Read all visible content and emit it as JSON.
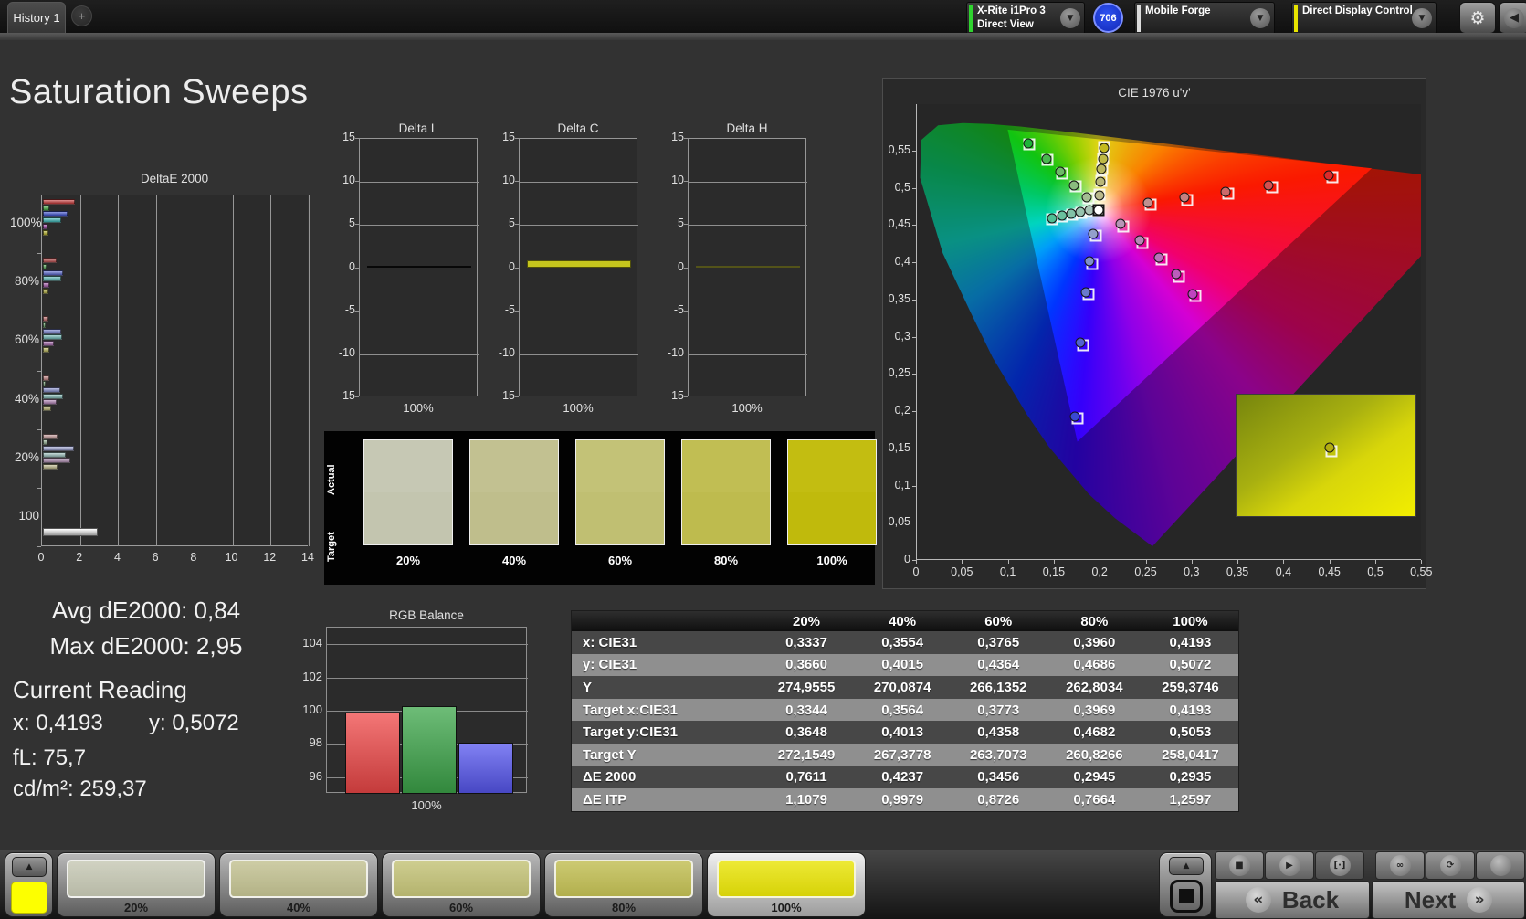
{
  "topbar": {
    "tabs": [
      {
        "label": "History 1",
        "active": true
      }
    ],
    "add_tab_icon": "+",
    "devices": [
      {
        "line1": "X-Rite i1Pro 3",
        "line2": "Direct View",
        "accent": "#2fd42f"
      },
      {
        "line1": "Mobile Forge",
        "line2": "",
        "accent": "#dcdcdc"
      },
      {
        "line1": "Direct Display Control",
        "line2": "",
        "accent": "#e8e400"
      }
    ],
    "badge": "706",
    "gear_icon": "⚙",
    "collapse_icon": "◀",
    "chevron_icon": "▼"
  },
  "page_title": "Saturation Sweeps",
  "stats": {
    "avg": "Avg dE2000: 0,84",
    "max": "Max dE2000: 2,95",
    "current_reading_title": "Current Reading",
    "x": "x: 0,4193",
    "y": "y: 0,5072",
    "fl": "fL: 75,7",
    "cdm2": "cd/m²: 259,37"
  },
  "swatch_compare": {
    "row_labels": [
      "Actual",
      "Target"
    ],
    "items": [
      {
        "label": "20%",
        "actual": "#c6c8b4",
        "target": "#c3c5af"
      },
      {
        "label": "40%",
        "actual": "#c2c191",
        "target": "#bfbe8c"
      },
      {
        "label": "60%",
        "actual": "#c3c277",
        "target": "#c0bf72"
      },
      {
        "label": "80%",
        "actual": "#c1be53",
        "target": "#bebb4e"
      },
      {
        "label": "100%",
        "actual": "#c3bd11",
        "target": "#c0ba0c"
      }
    ]
  },
  "table": {
    "headers": [
      "",
      "20%",
      "40%",
      "60%",
      "80%",
      "100%"
    ],
    "rows": [
      {
        "label": "x: CIE31",
        "values": [
          "0,3337",
          "0,3554",
          "0,3765",
          "0,3960",
          "0,4193"
        ]
      },
      {
        "label": "y: CIE31",
        "values": [
          "0,3660",
          "0,4015",
          "0,4364",
          "0,4686",
          "0,5072"
        ]
      },
      {
        "label": "Y",
        "values": [
          "274,9555",
          "270,0874",
          "266,1352",
          "262,8034",
          "259,3746"
        ]
      },
      {
        "label": "Target x:CIE31",
        "values": [
          "0,3344",
          "0,3564",
          "0,3773",
          "0,3969",
          "0,4193"
        ]
      },
      {
        "label": "Target y:CIE31",
        "values": [
          "0,3648",
          "0,4013",
          "0,4358",
          "0,4682",
          "0,5053"
        ]
      },
      {
        "label": "Target Y",
        "values": [
          "272,1549",
          "267,3778",
          "263,7073",
          "260,8266",
          "258,0417"
        ]
      },
      {
        "label": "ΔE 2000",
        "values": [
          "0,7611",
          "0,4237",
          "0,3456",
          "0,2945",
          "0,2935"
        ]
      },
      {
        "label": "ΔE ITP",
        "values": [
          "1,1079",
          "0,9979",
          "0,8726",
          "0,7664",
          "1,2597"
        ]
      }
    ]
  },
  "chart_data": [
    {
      "id": "deltae2000",
      "type": "bar",
      "orientation": "horizontal",
      "title": "DeltaE 2000",
      "group_labels": [
        "100%",
        "80%",
        "60%",
        "40%",
        "20%",
        "100"
      ],
      "xlim": [
        0,
        14
      ],
      "xtick_labels": [
        "0",
        "2",
        "4",
        "6",
        "8",
        "10",
        "12",
        "14"
      ],
      "series": [
        {
          "name": "red",
          "values": [
            1.7,
            0.7,
            0.27,
            0.35,
            0.79,
            null
          ],
          "colors": [
            "#c63434",
            "#c05050",
            "#bf6868",
            "#c07d7d",
            "#c39595"
          ]
        },
        {
          "name": "green",
          "values": [
            0.32,
            0.19,
            0.16,
            0.16,
            0.22,
            null
          ],
          "colors": [
            "#3aa83a",
            "#55a855",
            "#6aaa6a",
            "#7fad7f",
            "#95b295"
          ]
        },
        {
          "name": "blue",
          "values": [
            1.3,
            1.06,
            0.95,
            0.9,
            1.65,
            null
          ],
          "colors": [
            "#3a4ed0",
            "#5563cc",
            "#6e79cc",
            "#858dce",
            "#9aa0d2"
          ]
        },
        {
          "name": "cyan",
          "values": [
            0.95,
            0.98,
            1.02,
            1.06,
            1.22,
            null
          ],
          "colors": [
            "#3ab8b8",
            "#55bab6",
            "#6fbcb8",
            "#86beba",
            "#9cc2be"
          ]
        },
        {
          "name": "magenta",
          "values": [
            0.22,
            0.32,
            0.59,
            0.7,
            1.43,
            null
          ],
          "colors": [
            "#a040a8",
            "#a558aa",
            "#ab6cb0",
            "#b180b4",
            "#b795ba"
          ]
        },
        {
          "name": "yellow",
          "values": [
            0.29,
            0.29,
            0.35,
            0.42,
            0.76,
            null
          ],
          "colors": [
            "#b8b428",
            "#b9b544",
            "#bbb75c",
            "#bdb974",
            "#c0bc8c"
          ]
        },
        {
          "name": "white",
          "values": [
            null,
            null,
            null,
            null,
            null,
            2.89
          ],
          "colors": [
            "#f2f2f2",
            "#f2f2f2",
            "#f2f2f2",
            "#f2f2f2",
            "#f2f2f2"
          ]
        }
      ]
    },
    {
      "id": "delta_l",
      "type": "bar",
      "title": "Delta L",
      "categories": [
        "100%"
      ],
      "values": [
        0.25
      ],
      "bar_color": "#161616",
      "ylim": [
        -15,
        15
      ],
      "ytick_labels": [
        "15",
        "10",
        "5",
        "0",
        "-5",
        "-10",
        "-15"
      ]
    },
    {
      "id": "delta_c",
      "type": "bar",
      "title": "Delta C",
      "categories": [
        "100%"
      ],
      "values": [
        0.85
      ],
      "bar_color": "#c5c51d",
      "ylim": [
        -15,
        15
      ],
      "ytick_labels": [
        "15",
        "10",
        "5",
        "0",
        "-5",
        "-10",
        "-15"
      ]
    },
    {
      "id": "delta_h",
      "type": "bar",
      "title": "Delta H",
      "categories": [
        "100%"
      ],
      "values": [
        0.3
      ],
      "bar_color": "#cfcf40",
      "ylim": [
        -15,
        15
      ],
      "ytick_labels": [
        "15",
        "10",
        "5",
        "0",
        "-5",
        "-10",
        "-15"
      ]
    },
    {
      "id": "rgb_balance",
      "type": "bar",
      "title": "RGB Balance",
      "categories": [
        "red",
        "green",
        "blue"
      ],
      "values": [
        99.9,
        100.3,
        98.1
      ],
      "colors": [
        "#ef4848",
        "#3da64a",
        "#5757ef"
      ],
      "ylim": [
        95,
        105
      ],
      "ytick_labels": [
        "104",
        "102",
        "100",
        "98",
        "96"
      ],
      "xlabel": "100%"
    },
    {
      "id": "cie_diagram",
      "type": "scatter",
      "title": "CIE 1976 u'v'",
      "xtick_labels": [
        "0",
        "0,05",
        "0,1",
        "0,15",
        "0,2",
        "0,25",
        "0,3",
        "0,35",
        "0,4",
        "0,45",
        "0,5",
        "0,55"
      ],
      "ytick_labels": [
        "0",
        "0,05",
        "0,1",
        "0,15",
        "0,2",
        "0,25",
        "0,3",
        "0,35",
        "0,4",
        "0,45",
        "0,5",
        "0,55"
      ],
      "white_point": [
        0.198,
        0.47
      ],
      "sweeps": [
        {
          "name": "yellow",
          "point_colors": [
            "#b9b98c",
            "#b9b878",
            "#bcb961",
            "#bfb944",
            "#c4ba1e"
          ],
          "measured": [
            [
              0.1985,
              0.4898
            ],
            [
              0.2,
              0.5084
            ],
            [
              0.2012,
              0.5248
            ],
            [
              0.2023,
              0.5385
            ],
            [
              0.2034,
              0.5534
            ]
          ],
          "target": [
            [
              0.199,
              0.491
            ],
            [
              0.2004,
              0.5092
            ],
            [
              0.2016,
              0.5256
            ],
            [
              0.2028,
              0.5392
            ],
            [
              0.204,
              0.5546
            ]
          ]
        },
        {
          "name": "green",
          "point_colors": [
            "#a3bd92",
            "#8abc7e",
            "#6cba67",
            "#4ab750",
            "#1fb43a"
          ],
          "measured": [
            [
              0.1853,
              0.4868
            ],
            [
              0.1713,
              0.503
            ],
            [
              0.1563,
              0.521
            ],
            [
              0.1408,
              0.5392
            ],
            [
              0.121,
              0.56
            ]
          ],
          "target": [
            [
              0.1868,
              0.4853
            ],
            [
              0.1728,
              0.5015
            ],
            [
              0.1578,
              0.5195
            ],
            [
              0.1423,
              0.5377
            ],
            [
              0.1225,
              0.5585
            ]
          ]
        },
        {
          "name": "cyan",
          "point_colors": [
            "#a9c4b6",
            "#96c3ae",
            "#81c2a7",
            "#6ac19e",
            "#50bf94"
          ],
          "measured": [
            [
              0.1878,
              0.4698
            ],
            [
              0.1778,
              0.4672
            ],
            [
              0.1678,
              0.4648
            ],
            [
              0.1578,
              0.4622
            ],
            [
              0.1468,
              0.4592
            ]
          ],
          "target": [
            [
              0.1885,
              0.4685
            ],
            [
              0.1785,
              0.466
            ],
            [
              0.1685,
              0.4635
            ],
            [
              0.1585,
              0.461
            ],
            [
              0.1475,
              0.458
            ]
          ]
        },
        {
          "name": "red",
          "point_colors": [
            "#c09090",
            "#c57f7f",
            "#cc6a6a",
            "#d35050",
            "#dd2a2a"
          ],
          "measured": [
            [
              0.2515,
              0.4798
            ],
            [
              0.2912,
              0.4868
            ],
            [
              0.3363,
              0.4948
            ],
            [
              0.3832,
              0.5032
            ],
            [
              0.448,
              0.5165
            ]
          ],
          "target": [
            [
              0.2545,
              0.4768
            ],
            [
              0.2942,
              0.4838
            ],
            [
              0.3393,
              0.4918
            ],
            [
              0.3862,
              0.5002
            ],
            [
              0.452,
              0.5135
            ]
          ]
        },
        {
          "name": "magenta",
          "point_colors": [
            "#b795b7",
            "#b883b8",
            "#ba70ba",
            "#bc5cbc",
            "#bf44bf"
          ],
          "measured": [
            [
              0.2218,
              0.4512
            ],
            [
              0.2422,
              0.4292
            ],
            [
              0.263,
              0.4062
            ],
            [
              0.2822,
              0.3838
            ],
            [
              0.3002,
              0.3572
            ]
          ],
          "target": [
            [
              0.2248,
              0.4482
            ],
            [
              0.2452,
              0.4262
            ],
            [
              0.266,
              0.4032
            ],
            [
              0.2852,
              0.3808
            ],
            [
              0.3032,
              0.3542
            ]
          ]
        },
        {
          "name": "blue",
          "point_colors": [
            "#93a0cb",
            "#7e8ecc",
            "#6979ce",
            "#5161d0",
            "#3a48d2"
          ],
          "measured": [
            [
              0.1922,
              0.4382
            ],
            [
              0.1882,
              0.401
            ],
            [
              0.1842,
              0.3598
            ],
            [
              0.1782,
              0.2918
            ],
            [
              0.1722,
              0.1932
            ]
          ],
          "target": [
            [
              0.1952,
              0.4352
            ],
            [
              0.1912,
              0.398
            ],
            [
              0.1872,
              0.3568
            ],
            [
              0.1812,
              0.2888
            ],
            [
              0.1752,
              0.1902
            ]
          ]
        }
      ]
    }
  ],
  "bottom_bar": {
    "up_icon": "▲",
    "current_patch_color": "#fdff00",
    "patches": [
      {
        "label": "20%",
        "color": "#c6c8b4",
        "selected": false
      },
      {
        "label": "40%",
        "color": "#c2c191",
        "selected": false
      },
      {
        "label": "60%",
        "color": "#c3c277",
        "selected": false
      },
      {
        "label": "80%",
        "color": "#c1be53",
        "selected": false
      },
      {
        "label": "100%",
        "color": "#e9e408",
        "selected": true
      }
    ],
    "transport": [
      {
        "name": "stop",
        "glyph": "■"
      },
      {
        "name": "play",
        "glyph": "▶"
      },
      {
        "name": "single-measure",
        "glyph": "[·]"
      },
      {
        "name": "continuous",
        "glyph": "∞"
      },
      {
        "name": "loop",
        "glyph": "⟳"
      },
      {
        "name": "blank",
        "glyph": ""
      }
    ],
    "back_label": "Back",
    "next_label": "Next",
    "back_icon": "«",
    "next_icon": "»"
  }
}
